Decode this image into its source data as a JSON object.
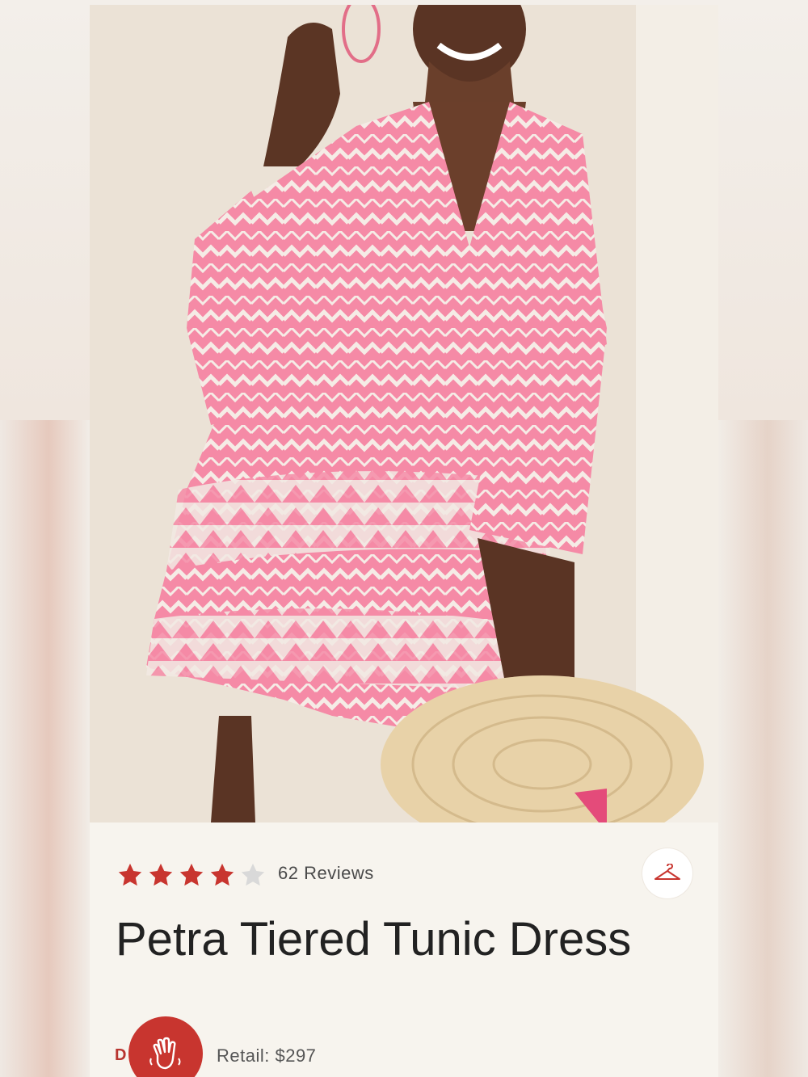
{
  "product": {
    "image_alt": "Pink and white patterned tiered tunic dress",
    "rating": 4,
    "rating_max": 5,
    "review_count_label": "62 Reviews",
    "title": "Petra Tiered Tunic Dress",
    "brand_initial": "D",
    "retail_label": "Retail: $297"
  },
  "icons": {
    "star": "star-icon",
    "hanger": "hanger-icon",
    "wave": "waving-hand-icon"
  },
  "colors": {
    "accent": "#c8352f",
    "star_filled": "#c8352f",
    "star_empty": "#d9d9d9",
    "dress_pink": "#f58aa6",
    "text": "#222222"
  }
}
